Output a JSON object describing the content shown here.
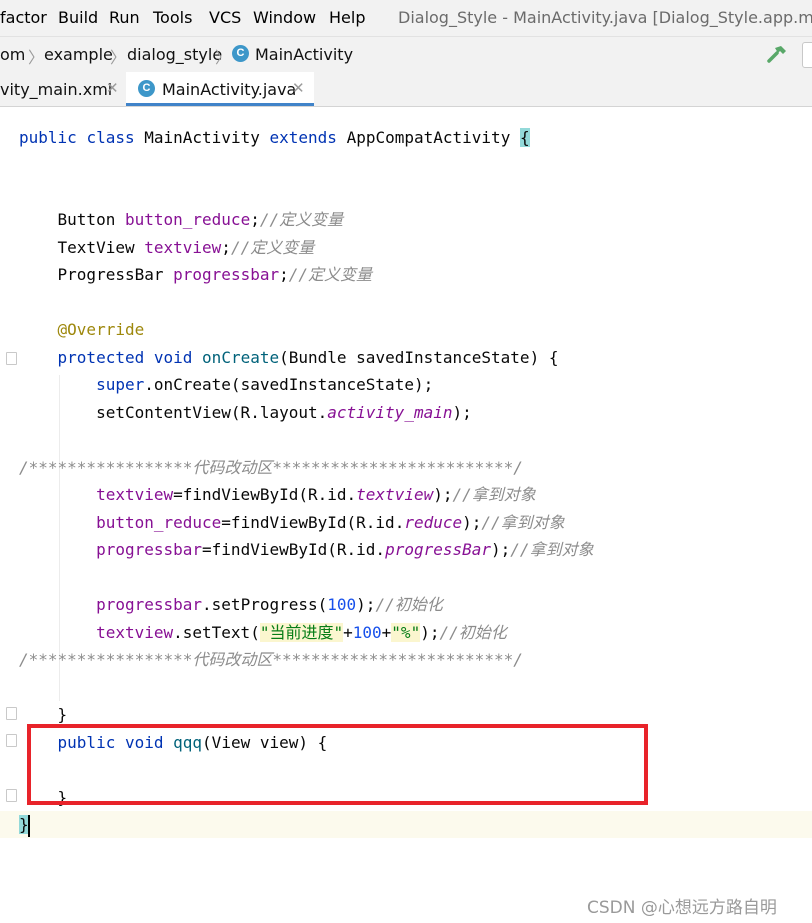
{
  "menu": {
    "items": [
      "factor",
      "Build",
      "Run",
      "Tools",
      "VCS",
      "Window",
      "Help"
    ],
    "window_title": "Dialog_Style - MainActivity.java [Dialog_Style.app.main]"
  },
  "breadcrumb": {
    "items": [
      "om",
      "example",
      "dialog_style",
      "MainActivity"
    ],
    "separator": "〉"
  },
  "tabs": [
    {
      "label": "vity_main.xml",
      "active": false
    },
    {
      "label": "MainActivity.java",
      "active": true
    }
  ],
  "code": {
    "class_decl": {
      "kw1": "public",
      "kw2": "class",
      "name": "MainActivity",
      "kw3": "extends",
      "parent": "AppCompatActivity",
      "brace": "{"
    },
    "field1": {
      "type": "Button",
      "name": "button_reduce",
      "semi": ";",
      "comment": "//定义变量"
    },
    "field2": {
      "type": "TextView",
      "name": "textview",
      "semi": ";",
      "comment": "//定义变量"
    },
    "field3": {
      "type": "ProgressBar",
      "name": "progressbar",
      "semi": ";",
      "comment": "//定义变量"
    },
    "annotation": "@Override",
    "oncreate": {
      "kw1": "protected",
      "kw2": "void",
      "name": "onCreate",
      "params": "(Bundle savedInstanceState) {"
    },
    "super_call": {
      "kw": "super",
      "rest": ".onCreate(savedInstanceState);"
    },
    "setcontent": {
      "pre": "setContentView(R.layout.",
      "ref": "activity_main",
      "post": ");"
    },
    "region_start": "/*****************代码改动区*************************/",
    "find1": {
      "field": "textview",
      "pre": "=findViewById(R.id.",
      "ref": "textview",
      "post": ");",
      "comment": "//拿到对象"
    },
    "find2": {
      "field": "button_reduce",
      "pre": "=findViewById(R.id.",
      "ref": "reduce",
      "post": ");",
      "comment": "//拿到对象"
    },
    "find3": {
      "field": "progressbar",
      "pre": "=findViewById(R.id.",
      "ref": "progressBar",
      "post": ");",
      "comment": "//拿到对象"
    },
    "setprogress": {
      "field": "progressbar",
      "pre": ".setProgress(",
      "num": "100",
      "post": ");",
      "comment": "//初始化"
    },
    "settext": {
      "field": "textview",
      "pre": ".setText(",
      "str1": "\"当前进度\"",
      "plus1": "+",
      "num": "100",
      "plus2": "+",
      "str2": "\"%\"",
      "post": ");",
      "comment": "//初始化"
    },
    "region_end": "/*****************代码改动区*************************/",
    "close_method": "}",
    "qqq": {
      "kw1": "public",
      "kw2": "void",
      "name": "qqq",
      "params": "(View view) {"
    },
    "close_qqq": "}",
    "close_class": "}"
  },
  "watermark": "CSDN @心想远方路自明",
  "colors": {
    "highlight_box": "#e8232a",
    "active_tab_underline": "#4083c9"
  }
}
